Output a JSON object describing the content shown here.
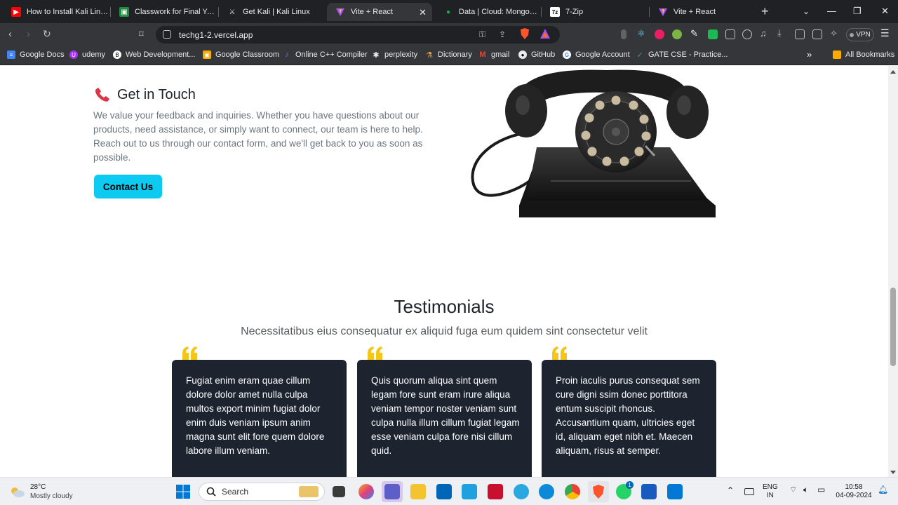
{
  "tabs": [
    {
      "title": "How to Install Kali Linux in",
      "icon": "youtube-icon"
    },
    {
      "title": "Classwork for Final Year C",
      "icon": "classroom-icon"
    },
    {
      "title": "Get Kali | Kali Linux",
      "icon": "kali-icon"
    },
    {
      "title": "Vite + React",
      "icon": "vite-icon",
      "active": true
    },
    {
      "title": "Data | Cloud: MongoDB C",
      "icon": "mongodb-icon"
    },
    {
      "title": "7-Zip",
      "icon": "7zip-icon"
    },
    {
      "title": "Vite + React",
      "icon": "vite-icon"
    }
  ],
  "address": {
    "url": "techg1-2.vercel.app"
  },
  "vpn_label": "VPN",
  "bookmarks": [
    {
      "label": "Google Docs"
    },
    {
      "label": "udemy"
    },
    {
      "label": "Web Development..."
    },
    {
      "label": "Google Classroom"
    },
    {
      "label": "Online C++ Compiler"
    },
    {
      "label": "perplexity"
    },
    {
      "label": "Dictionary"
    },
    {
      "label": "gmail"
    },
    {
      "label": "GitHub"
    },
    {
      "label": "Google Account"
    },
    {
      "label": "GATE CSE - Practice..."
    }
  ],
  "all_bookmarks": "All Bookmarks",
  "contact": {
    "title": "Get in Touch",
    "text": "We value your feedback and inquiries. Whether you have questions about our products, need assistance, or simply want to connect, our team is here to help. Reach out to us through our contact form, and we'll get back to you as soon as possible.",
    "button": "Contact Us"
  },
  "testimonials": {
    "title": "Testimonials",
    "subtitle": "Necessitatibus eius consequatur ex aliquid fuga eum quidem sint consectetur velit",
    "cards": [
      {
        "text": "Fugiat enim eram quae cillum dolore dolor amet nulla culpa multos export minim fugiat dolor enim duis veniam ipsum anim magna sunt elit fore quem dolore labore illum veniam."
      },
      {
        "text": "Quis quorum aliqua sint quem legam fore sunt eram irure aliqua veniam tempor noster veniam sunt culpa nulla illum cillum fugiat legam esse veniam culpa fore nisi cillum quid."
      },
      {
        "text": "Proin iaculis purus consequat sem cure digni ssim donec porttitora entum suscipit rhoncus. Accusantium quam, ultricies eget id, aliquam eget nibh et. Maecen aliquam, risus at semper."
      }
    ]
  },
  "taskbar": {
    "weather_temp": "28°C",
    "weather_desc": "Mostly cloudy",
    "search_label": "Search",
    "lang_1": "ENG",
    "lang_2": "IN",
    "time": "10:58",
    "date": "04-09-2024",
    "badge_1": "1"
  },
  "colors": {
    "accent": "#0dcaf0",
    "card_bg": "#1d2430",
    "quote": "#f5c518",
    "phone_icon": "#dc3545"
  }
}
